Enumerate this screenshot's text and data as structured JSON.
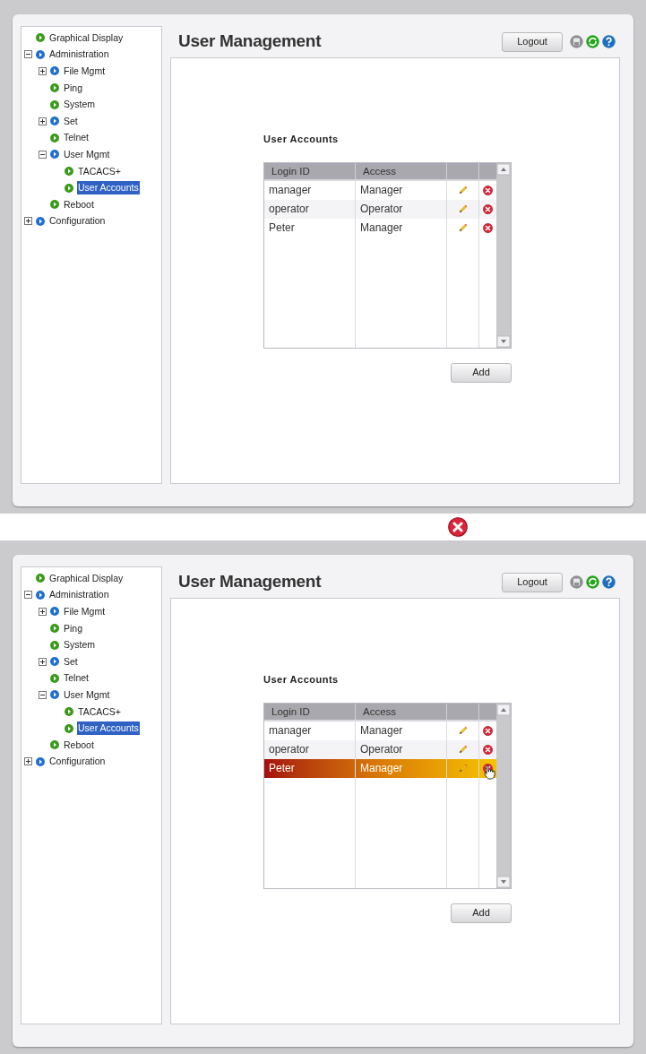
{
  "screens": [
    {
      "tree": [
        {
          "label": "Graphical Display",
          "kind": "leaf",
          "selected": false
        },
        {
          "label": "Administration",
          "kind": "branch",
          "expanded": true,
          "selected": false,
          "children": [
            {
              "label": "File Mgmt",
              "kind": "branch",
              "expanded": false,
              "selected": false
            },
            {
              "label": "Ping",
              "kind": "leaf",
              "selected": false
            },
            {
              "label": "System",
              "kind": "leaf",
              "selected": false
            },
            {
              "label": "Set",
              "kind": "branch",
              "expanded": false,
              "selected": false
            },
            {
              "label": "Telnet",
              "kind": "leaf",
              "selected": false
            },
            {
              "label": "User Mgmt",
              "kind": "branch",
              "expanded": true,
              "selected": false,
              "children": [
                {
                  "label": "TACACS+",
                  "kind": "leaf",
                  "selected": false
                },
                {
                  "label": "User Accounts",
                  "kind": "leaf",
                  "selected": true
                }
              ]
            },
            {
              "label": "Reboot",
              "kind": "leaf",
              "selected": false
            }
          ]
        },
        {
          "label": "Configuration",
          "kind": "branch",
          "expanded": false,
          "selected": false
        }
      ],
      "title": "User Management",
      "logout": "Logout",
      "section_title": "User Accounts",
      "columns": [
        "Login ID",
        "Access"
      ],
      "rows": [
        {
          "login_id": "manager",
          "access": "Manager",
          "selected": false
        },
        {
          "login_id": "operator",
          "access": "Operator",
          "selected": false
        },
        {
          "login_id": "Peter",
          "access": "Manager",
          "selected": false
        }
      ],
      "add_button": "Add"
    },
    {
      "tree": [
        {
          "label": "Graphical Display",
          "kind": "leaf",
          "selected": false
        },
        {
          "label": "Administration",
          "kind": "branch",
          "expanded": true,
          "selected": false,
          "children": [
            {
              "label": "File Mgmt",
              "kind": "branch",
              "expanded": false,
              "selected": false
            },
            {
              "label": "Ping",
              "kind": "leaf",
              "selected": false
            },
            {
              "label": "System",
              "kind": "leaf",
              "selected": false
            },
            {
              "label": "Set",
              "kind": "branch",
              "expanded": false,
              "selected": false
            },
            {
              "label": "Telnet",
              "kind": "leaf",
              "selected": false
            },
            {
              "label": "User Mgmt",
              "kind": "branch",
              "expanded": true,
              "selected": false,
              "children": [
                {
                  "label": "TACACS+",
                  "kind": "leaf",
                  "selected": false
                },
                {
                  "label": "User Accounts",
                  "kind": "leaf",
                  "selected": true
                }
              ]
            },
            {
              "label": "Reboot",
              "kind": "leaf",
              "selected": false
            }
          ]
        },
        {
          "label": "Configuration",
          "kind": "branch",
          "expanded": false,
          "selected": false
        }
      ],
      "title": "User Management",
      "logout": "Logout",
      "section_title": "User Accounts",
      "columns": [
        "Login ID",
        "Access"
      ],
      "rows": [
        {
          "login_id": "manager",
          "access": "Manager",
          "selected": false
        },
        {
          "login_id": "operator",
          "access": "Operator",
          "selected": false
        },
        {
          "login_id": "Peter",
          "access": "Manager",
          "selected": true
        }
      ],
      "add_button": "Add"
    }
  ]
}
